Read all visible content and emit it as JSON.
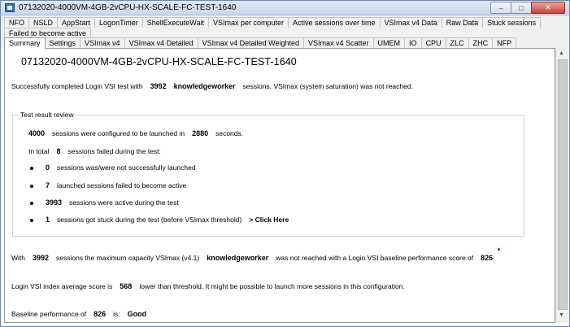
{
  "window": {
    "title": "07132020-4000VM-4GB-2vCPU-HX-SCALE-FC-TEST-1640",
    "buttons": {
      "minimize": "–",
      "maximize": "□",
      "close": "✕"
    }
  },
  "tabs_row1": [
    "NFO",
    "NSLD",
    "AppStart",
    "LogonTimer",
    "ShellExecuteWait",
    "VSImax per computer",
    "Active sessions over time",
    "VSImax v4 Data",
    "Raw Data",
    "Stuck sessions"
  ],
  "tabs_row2": [
    "Failed to become active"
  ],
  "tabs_row3": [
    "Summary",
    "Settings",
    "VSImax v4",
    "VSImax v4 Detailed",
    "VSImax v4 Detailed Weighted",
    "VSImax v4 Scatter",
    "UMEM",
    "IO",
    "CPU",
    "ZLC",
    "ZHC",
    "NFP"
  ],
  "active_tab": "Summary",
  "summary": {
    "page_title": "07132020-4000VM-4GB-2vCPU-HX-SCALE-FC-TEST-1640",
    "line1": {
      "pre": "Successfully completed Login VSI test with",
      "sessions": "3992",
      "workload": "knowledgeworker",
      "post": "sessions. VSImax (system saturation) was not reached."
    },
    "review": {
      "group_title": "Test result review",
      "configured": {
        "count": "4000",
        "text1": "sessions were configured to be launched in",
        "seconds": "2880",
        "text2": "seconds."
      },
      "failed": {
        "pre": "In total",
        "count": "8",
        "post": "sessions failed during the test:"
      },
      "items": [
        {
          "count": "0",
          "text": "sessions was/were not successfully launched"
        },
        {
          "count": "7",
          "text": "launched sessions failed to become active"
        },
        {
          "count": "3993",
          "text": "sessions were active during the test"
        },
        {
          "count": "1",
          "text": "sessions got stuck during the test (before VSImax threshold)",
          "link": "> Click Here"
        }
      ]
    },
    "capacity": {
      "pre": "With",
      "sessions": "3992",
      "text1": "sessions the maximum capacity VSImax (v4.1)",
      "workload": "knowledgeworker",
      "text2": "was not reached with a Login VSI baseline performance score of",
      "score": "826"
    },
    "index": {
      "pre": "Login VSI index average score is",
      "score": "568",
      "post": "lower than threshold. It might be possible to launch more sessions in this configuration."
    },
    "baseline": {
      "pre": "Baseline performance of",
      "score": "826",
      "mid": "is:",
      "rating": "Good"
    }
  },
  "colors": {
    "accent_dot": "#e00000",
    "title_bar": "#c9d8ec"
  }
}
